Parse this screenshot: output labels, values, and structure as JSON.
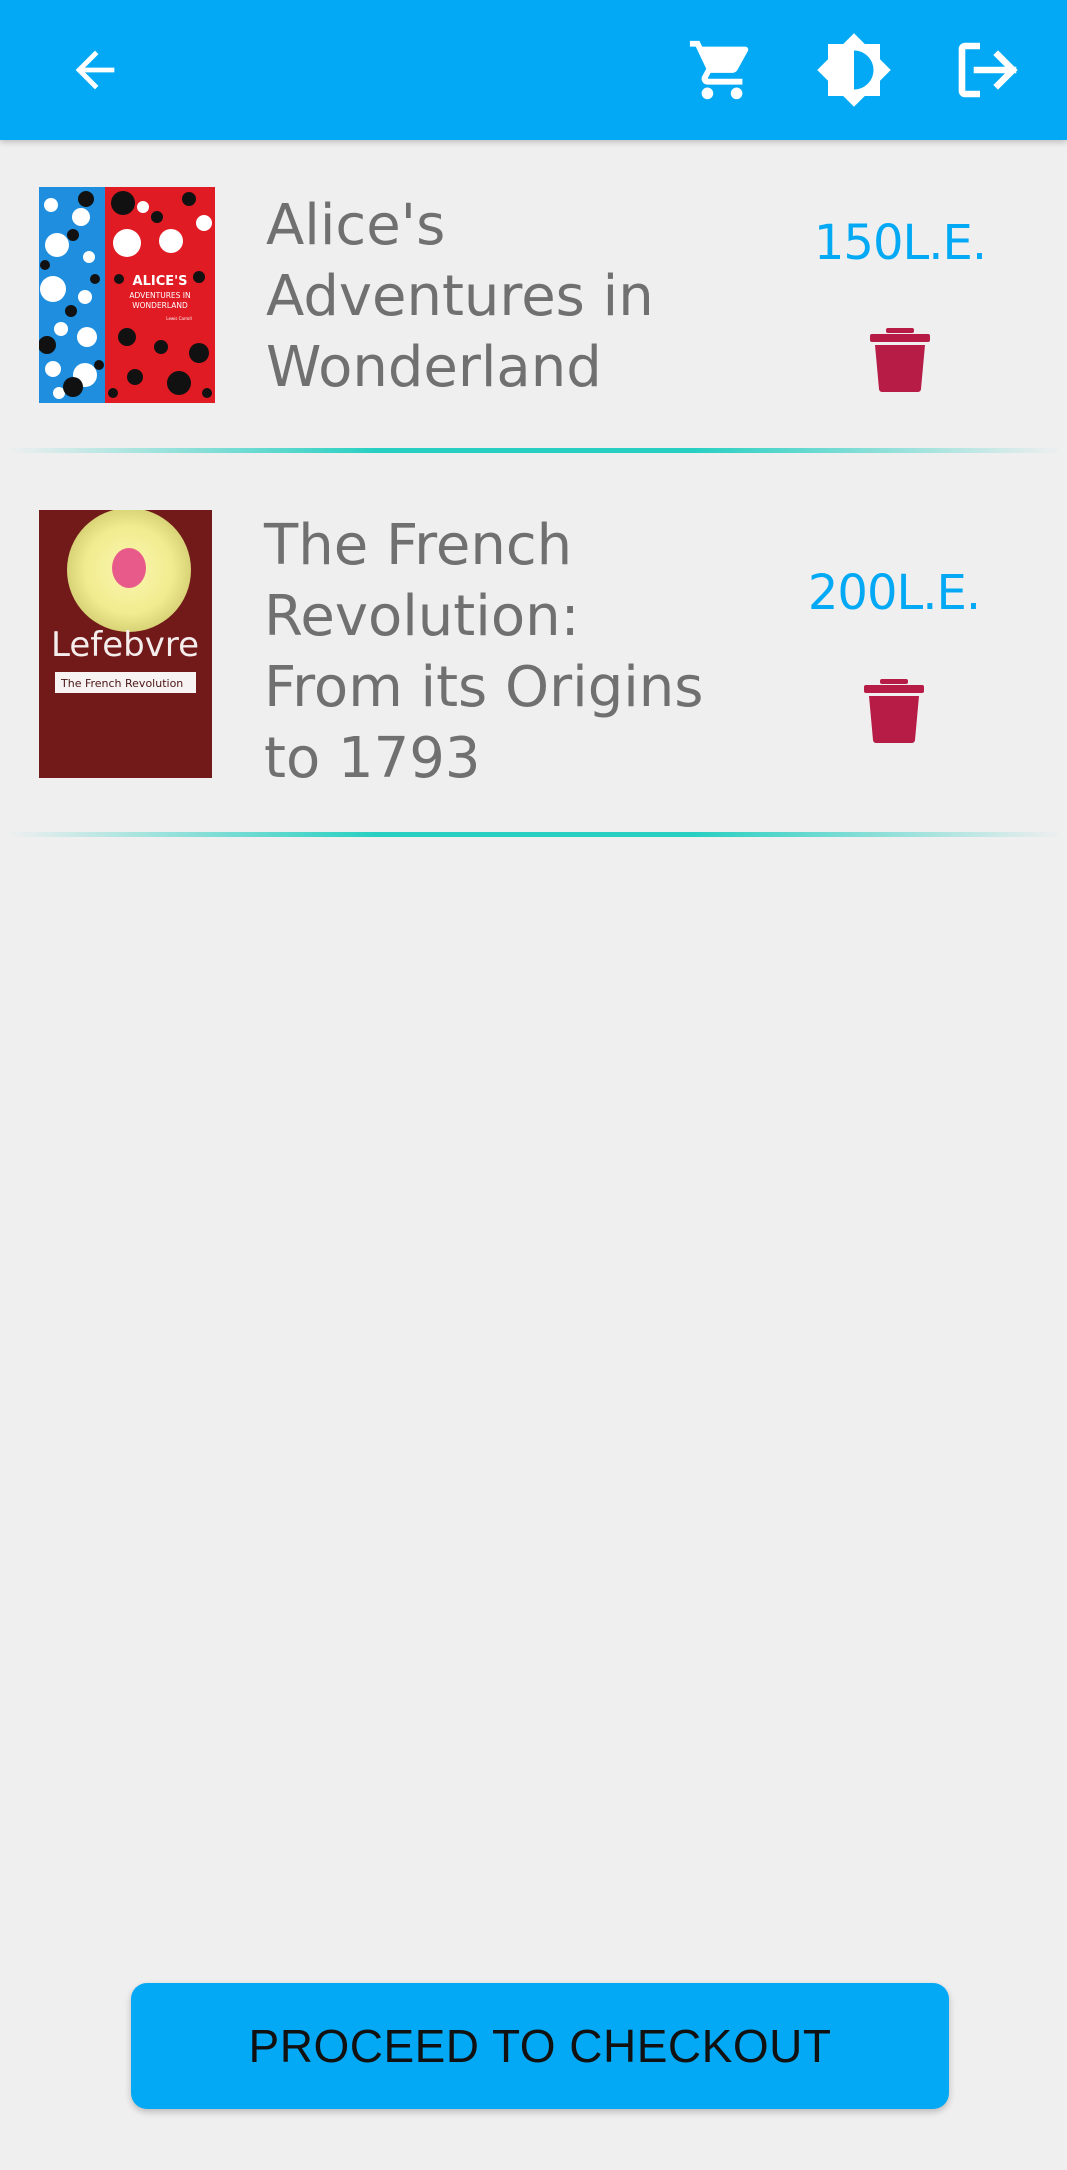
{
  "header": {
    "back_icon": "arrow-left-icon",
    "cart_icon": "cart-icon",
    "theme_icon": "brightness-icon",
    "logout_icon": "logout-icon",
    "bar_color": "#03a9f4"
  },
  "cart": {
    "items": [
      {
        "title": "Alice's Adventures in Wonderland",
        "price": "150L.E.",
        "cover_text": "ALICE'S ADVENTURES IN WONDERLAND",
        "delete_icon": "trash-icon"
      },
      {
        "title": "The French Revolution: From its Origins to 1793",
        "price": "200L.E.",
        "cover_author": "Lefebvre",
        "cover_subtitle": "The French Revolution",
        "delete_icon": "trash-icon"
      }
    ]
  },
  "checkout": {
    "label": "PROCEED TO CHECKOUT"
  },
  "colors": {
    "accent": "#03a9f4",
    "price": "#03a9f4",
    "delete": "#b71c47",
    "divider": "#27cfc1",
    "background": "#efefef"
  }
}
